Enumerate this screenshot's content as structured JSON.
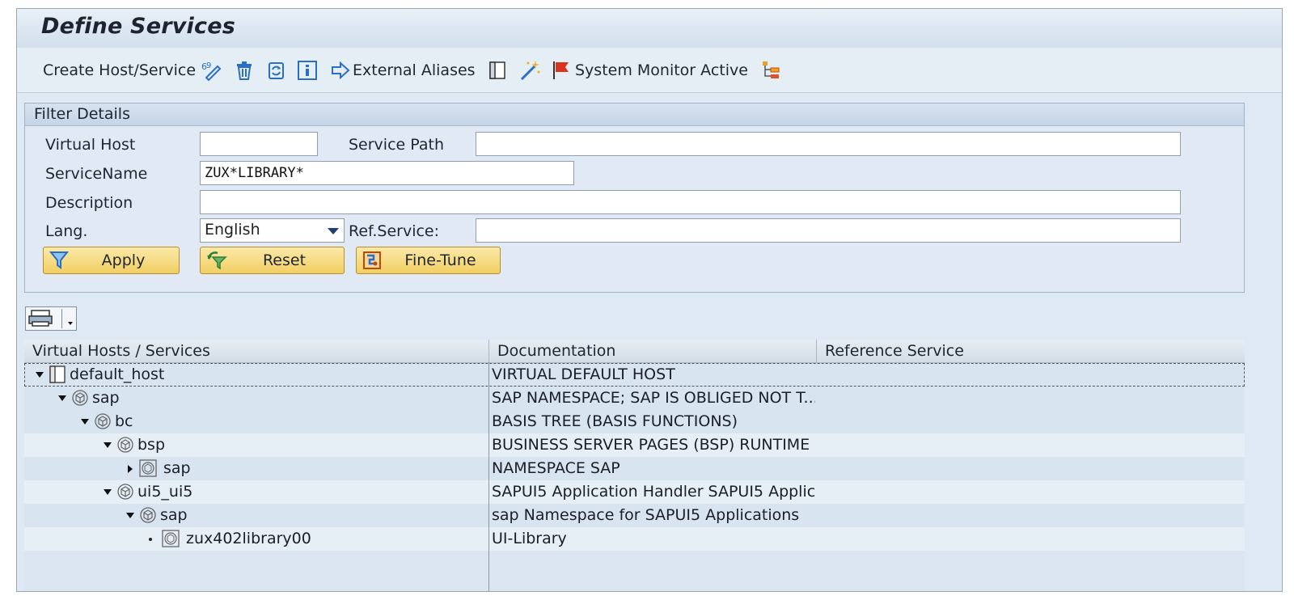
{
  "title": "Define Services",
  "toolbar": {
    "create_label": "Create Host/Service",
    "external_aliases_label": "External Aliases",
    "system_monitor_label": "System Monitor Active"
  },
  "filter": {
    "header": "Filter Details",
    "virtual_host_label": "Virtual Host",
    "virtual_host_value": "",
    "service_path_label": "Service Path",
    "service_path_value": "",
    "service_name_label": "ServiceName",
    "service_name_value": "ZUX*LIBRARY*",
    "description_label": "Description",
    "description_value": "",
    "lang_label": "Lang.",
    "lang_value": "English",
    "ref_service_label": "Ref.Service:",
    "ref_service_value": "",
    "apply_label": "Apply",
    "reset_label": "Reset",
    "finetune_label": "Fine-Tune"
  },
  "grid": {
    "columns": [
      "Virtual Hosts / Services",
      "Documentation",
      "Reference Service"
    ],
    "rows": [
      {
        "name": "default_host",
        "doc": "VIRTUAL DEFAULT HOST"
      },
      {
        "name": "sap",
        "doc": "SAP NAMESPACE; SAP IS OBLIGED NOT T..."
      },
      {
        "name": "bc",
        "doc": "BASIS TREE (BASIS FUNCTIONS)"
      },
      {
        "name": "bsp",
        "doc": "BUSINESS SERVER PAGES (BSP) RUNTIME"
      },
      {
        "name": "sap",
        "doc": "NAMESPACE SAP"
      },
      {
        "name": "ui5_ui5",
        "doc": "SAPUI5 Application Handler SAPUI5 Applic..."
      },
      {
        "name": "sap",
        "doc": "sap Namespace for SAPUI5 Applications"
      },
      {
        "name": "zux402library00",
        "doc": "UI-Library"
      }
    ]
  },
  "colors": {
    "button_yellow": "#f2cf63",
    "panel_blue": "#dfe9f4",
    "flag_red": "#d9341e",
    "icon_blue": "#2a6fc2"
  }
}
